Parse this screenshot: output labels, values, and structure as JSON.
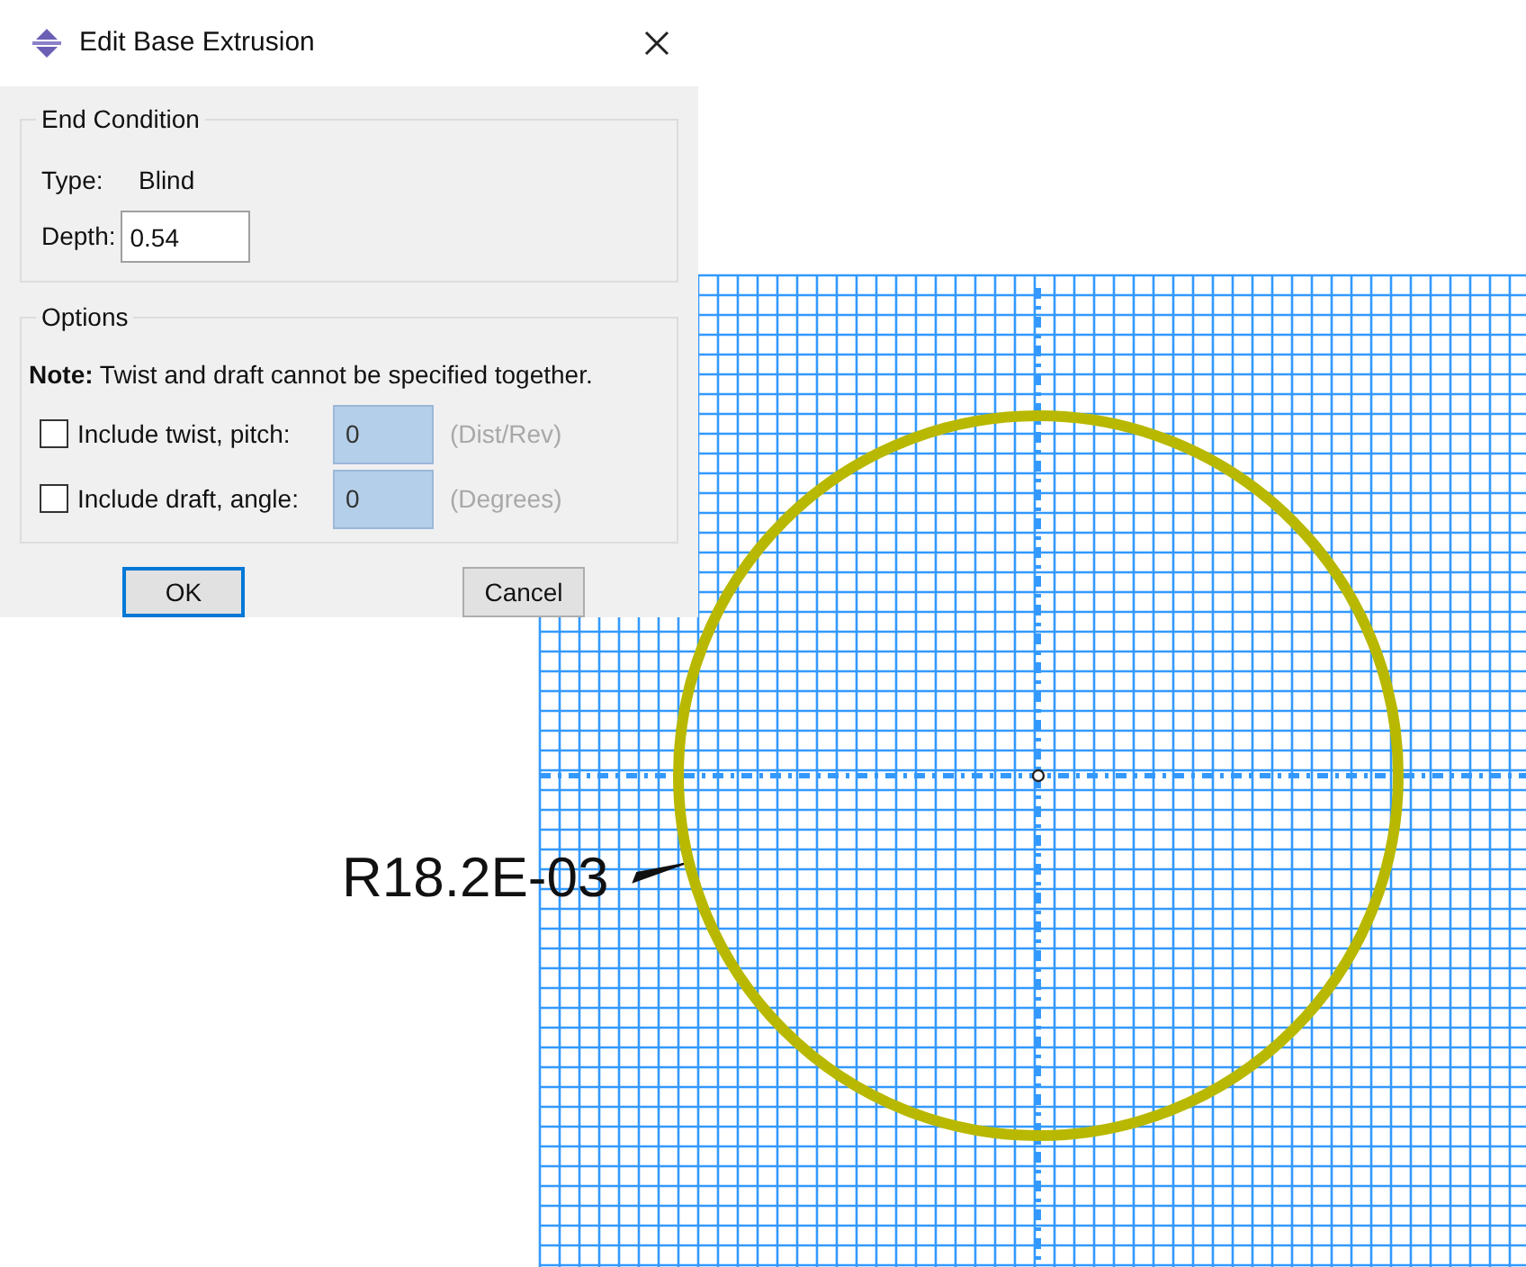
{
  "window": {
    "title": "Edit Base Extrusion"
  },
  "end_condition": {
    "title": "End Condition",
    "type_label": "Type:",
    "type_value": "Blind",
    "depth_label": "Depth:",
    "depth_value": "0.54"
  },
  "options": {
    "title": "Options",
    "note": "**Note:**  Twist and draft cannot be specified together.",
    "rows": [
      {
        "label": "Include twist, pitch:",
        "checked": false,
        "disabled": true,
        "value": "0",
        "unit": "(Dist/Rev)"
      },
      {
        "label": "Include draft, angle:",
        "checked": false,
        "disabled": true,
        "value": "0",
        "unit": "(Degrees)"
      }
    ]
  },
  "buttons": [
    {
      "label": "OK",
      "default": true
    },
    {
      "label": "Cancel",
      "default": false
    }
  ],
  "sketch": {
    "dimension": "R18.2E-03"
  }
}
